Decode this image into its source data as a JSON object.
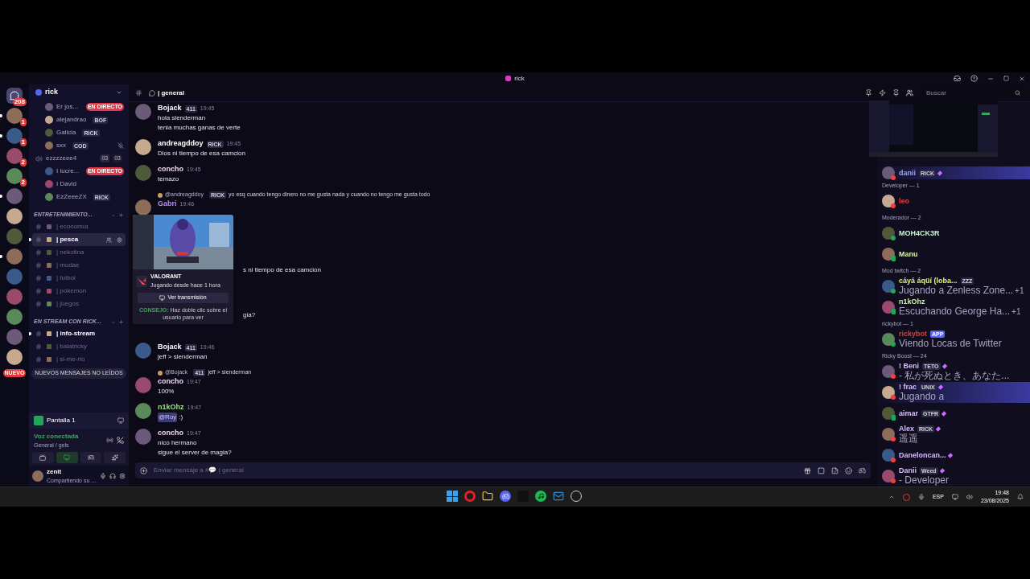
{
  "window": {
    "title": "rick"
  },
  "rail": {
    "items": [
      {
        "badge": "208",
        "unread": false
      },
      {
        "badge": "1",
        "unread": true
      },
      {
        "badge": "1",
        "unread": true
      },
      {
        "badge": "2",
        "unread": false
      },
      {
        "badge": "2",
        "unread": false
      },
      {
        "unread": true
      },
      {
        "unread": false
      },
      {
        "unread": false
      },
      {
        "unread": true
      },
      {
        "unread": false
      },
      {
        "unread": false
      },
      {
        "unread": false
      },
      {
        "unread": false
      },
      {
        "unread": false
      }
    ],
    "new_badge": "NUEVO"
  },
  "sidebar": {
    "server_name": "rick",
    "voice_users": [
      {
        "name": "Er jos...",
        "live": "EN DIRECTO"
      },
      {
        "name": "alejandrao",
        "tag": "BOF"
      },
      {
        "name": "Galicia",
        "tag": "RICK"
      },
      {
        "name": "sxx",
        "tag": "COD",
        "deafened": true
      }
    ],
    "voice_channel": {
      "name": "ezzzzeee4",
      "count": "03",
      "limit": "03",
      "users": [
        {
          "name": "I lucre...",
          "live": "EN DIRECTO"
        },
        {
          "name": "I David"
        },
        {
          "name": "EzZeeeZX",
          "tag": "RICK"
        }
      ]
    },
    "categories": [
      {
        "name": "ENTRETENIMIENTO...",
        "channels": [
          {
            "name": "| economía",
            "selected": false,
            "unread": false
          },
          {
            "name": "| pesca",
            "selected": true,
            "unread": true
          },
          {
            "name": "| nekotina",
            "selected": false,
            "unread": false
          },
          {
            "name": "| mudae",
            "selected": false,
            "unread": false
          },
          {
            "name": "| futbol",
            "selected": false,
            "unread": false
          },
          {
            "name": "| pokemon",
            "selected": false,
            "unread": false
          },
          {
            "name": "| juegos",
            "selected": false,
            "unread": false
          }
        ]
      },
      {
        "name": "EN STREAM CON RICK...",
        "channels": [
          {
            "name": "| info-stream",
            "selected": false,
            "unread": true
          },
          {
            "name": "| balatricky",
            "selected": false,
            "unread": false
          },
          {
            "name": "| si-me-rio",
            "selected": false,
            "unread": false
          }
        ]
      }
    ],
    "unread_banner": "NUEVOS MENSAJES NO LEÍDOS",
    "stream": {
      "label": "Pantalla 1"
    },
    "voice_status": {
      "title": "Voz conectada",
      "channel": "General / gels"
    },
    "user": {
      "name": "zenit",
      "status_text": "Compartiendo su ..."
    }
  },
  "chat": {
    "channel": "| general",
    "search_placeholder": "Buscar",
    "input_placeholder": "Enviar mensaje a #💬 | general",
    "messages": [
      {
        "author": "Bojack",
        "color": "#ffffff",
        "tag": "411",
        "time": "19:45",
        "lines": [
          "hola slenderman",
          "tenia muchas ganas de verte"
        ]
      },
      {
        "author": "andreagddoy",
        "color": "#ffffff",
        "tag": "RICK",
        "time": "19:45",
        "lines": [
          "Dios ni tiempo de esa camcion"
        ]
      },
      {
        "author": "concho",
        "color": "#f3d7ef",
        "time": "19:45",
        "lines": [
          "temazo"
        ]
      },
      {
        "author": "Gabri",
        "color": "#b98cff",
        "time": "19:46",
        "reply": {
          "author": "@andreagddoy",
          "tag": "RICK",
          "text": "yo esq cuando tengo dinero no me gusta nada y cuando no tengo me gusta todo"
        },
        "covered_lines": [
          "s ni tiempo de esa camcion",
          "gia?"
        ]
      },
      {
        "author": "Bojack",
        "color": "#ffffff",
        "tag": "411",
        "time": "19:46",
        "lines": [
          "jeff > slenderman"
        ]
      },
      {
        "author": "concho",
        "color": "#f3d7ef",
        "time": "19:47",
        "reply": {
          "author": "@Bojack",
          "tag": "411",
          "text": "jeff > slenderman"
        },
        "lines": [
          "100%"
        ]
      },
      {
        "author": "n1kOhz",
        "color": "#9fe08a",
        "time": "19:47",
        "mention": "@Roy",
        "lines": [
          ":)"
        ]
      },
      {
        "author": "concho",
        "color": "#f3d7ef",
        "time": "19:47",
        "lines": [
          "nico hermano",
          "sigue el server de magia?"
        ]
      }
    ],
    "popup": {
      "game": "VALORANT",
      "activity": "Jugando desde hace 1 hora",
      "button": "Ver transmisión",
      "tip_label": "CONSEJO:",
      "tip": "Haz doble clic sobre el usuario para ver"
    }
  },
  "members": {
    "top": [
      {
        "name": "danii",
        "color": "#8fa8ff",
        "presence": {
          "kind": "dot",
          "color": "#f23f43"
        },
        "tag": "RICK",
        "booster": true,
        "highlight": true
      }
    ],
    "groups": [
      {
        "title": "Developer — 1",
        "members": [
          {
            "name": "leo",
            "color": "#e23b3b",
            "presence": {
              "kind": "dot",
              "color": "#f23f43"
            },
            "booster": false,
            "highlight": false
          }
        ]
      },
      {
        "title": "Moderador — 2",
        "members": [
          {
            "name": "MOH4CK3R",
            "color": "#c9f7d2",
            "presence": {
              "kind": "dot",
              "color": "#23a55a"
            },
            "booster": false,
            "highlight": false
          },
          {
            "name": "Manu",
            "color": "#d6f7a8",
            "presence": {
              "kind": "phone",
              "color": "#23a55a"
            },
            "booster": false,
            "highlight": false
          }
        ]
      },
      {
        "title": "Mod twitch — 2",
        "members": [
          {
            "name": "cáyá áqüí (loba...",
            "color": "#e0f27a",
            "presence": {
              "kind": "dot",
              "color": "#23a55a"
            },
            "tag": "ZZZ",
            "activity": "Jugando a Zenless Zone...",
            "extra": "+1",
            "booster": false,
            "highlight": false
          },
          {
            "name": "n1kOhz",
            "color": "#c8f5a0",
            "presence": {
              "kind": "phone",
              "color": "#23a55a"
            },
            "activity": "Escuchando George Ha...",
            "extra": "+1",
            "booster": false,
            "highlight": false
          }
        ]
      },
      {
        "title": "rickybot — 1",
        "members": [
          {
            "name": "rickybot",
            "color": "#e23b3b",
            "presence": {
              "kind": "dot",
              "color": "#23a55a"
            },
            "app": "APP",
            "activity": "Viendo Locas de Twitter",
            "booster": false,
            "highlight": false
          }
        ]
      },
      {
        "title": "Ricky Boost — 24",
        "members": [
          {
            "name": "! Beni",
            "color": "#d9bfff",
            "presence": {
              "kind": "dot",
              "color": "#f23f43"
            },
            "tag": "TETO",
            "activity": "- 私が死ぬとき、あなた...",
            "booster": true,
            "highlight": false
          },
          {
            "name": "! frac",
            "color": "#d9bfff",
            "presence": {
              "kind": "dot",
              "color": "#f23f43"
            },
            "tag": "UNIX",
            "activity": "Jugando a",
            "booster": true,
            "highlight": true
          },
          {
            "name": "aimar",
            "color": "#d9bfff",
            "presence": {
              "kind": "phone",
              "color": "#23a55a"
            },
            "tag": "GTFR",
            "booster": true,
            "highlight": false
          },
          {
            "name": "Alex",
            "color": "#d9bfff",
            "presence": {
              "kind": "dot",
              "color": "#f23f43"
            },
            "tag": "RICK",
            "activity": "遥遥",
            "booster": true,
            "highlight": false
          },
          {
            "name": "Daneloncan...",
            "color": "#d9bfff",
            "presence": {
              "kind": "dot",
              "color": "#f23f43"
            },
            "booster": true,
            "highlight": false
          },
          {
            "name": "Danii",
            "color": "#d9bfff",
            "presence": {
              "kind": "dot",
              "color": "#f23f43"
            },
            "tag": "Weed",
            "activity": "- Developer",
            "booster": true,
            "highlight": false
          }
        ]
      }
    ]
  },
  "taskbar": {
    "language": "ESP",
    "time": "19:48",
    "date": "23/08/2025"
  }
}
